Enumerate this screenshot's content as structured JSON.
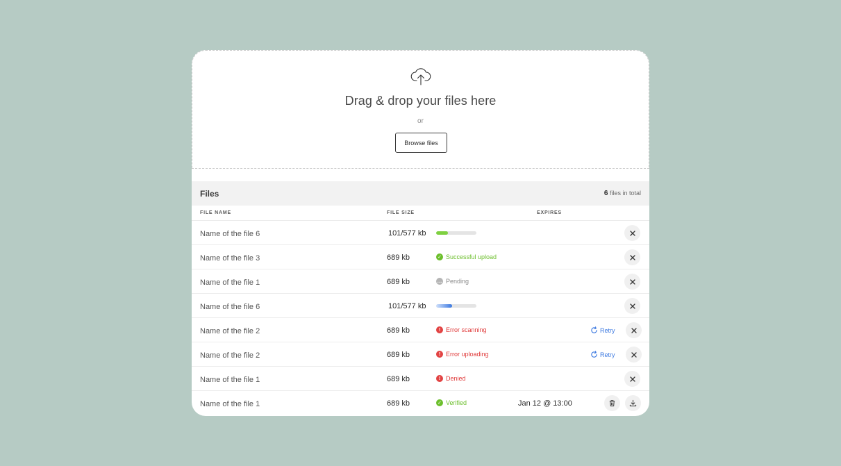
{
  "dropzone": {
    "icon": "cloud-upload-icon",
    "title": "Drag & drop your files here",
    "or": "or",
    "browse_label": "Browse files"
  },
  "files": {
    "title": "Files",
    "count": "6",
    "count_suffix": "files in total",
    "columns": {
      "name": "FILE NAME",
      "size": "FILE SIZE",
      "expires": "EXPIRES"
    }
  },
  "rows": [
    {
      "name": "Name of the file 6",
      "size": "101/577 kb",
      "progress": 0.3,
      "progress_color": "#7ed040"
    },
    {
      "name": "Name of the file 3",
      "size": "689 kb",
      "status": "Successful upload",
      "status_type": "ok"
    },
    {
      "name": "Name of the file 1",
      "size": "689 kb",
      "status": "Pending",
      "status_type": "pending"
    },
    {
      "name": "Name of the file 6",
      "size": "101/577 kb",
      "progress": 0.4,
      "progress_color": "#3b78e0"
    },
    {
      "name": "Name of the file 2",
      "size": "689 kb",
      "status": "Error scanning",
      "status_type": "error",
      "retry": "Retry"
    },
    {
      "name": "Name of the file 2",
      "size": "689 kb",
      "status": "Error uploading",
      "status_type": "error",
      "retry": "Retry"
    },
    {
      "name": "Name of the file 1",
      "size": "689 kb",
      "status": "Denied",
      "status_type": "error"
    },
    {
      "name": "Name of the file 1",
      "size": "689 kb",
      "status": "Verified",
      "status_type": "ok",
      "expires": "Jan 12 @ 13:00"
    }
  ],
  "colors": {
    "background": "#b6cbc4",
    "success": "#6cbf2c",
    "error": "#e03a3a",
    "link": "#3b78e0"
  }
}
